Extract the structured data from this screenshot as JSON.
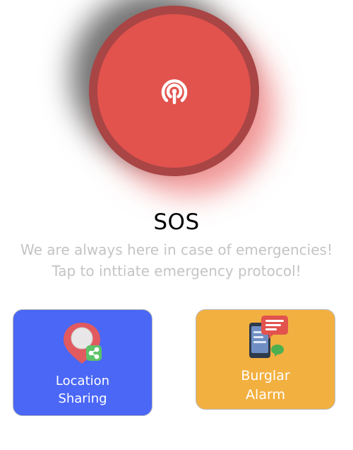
{
  "sos": {
    "title": "SOS",
    "subtitle_line1": "We are always here in case of emergencies!",
    "subtitle_line2": "Tap to inttiate emergency protocol!",
    "icon": "broadcast-signal-icon"
  },
  "cards": {
    "location": {
      "label_line1": "Location",
      "label_line2": "Sharing",
      "icon": "location-share-icon",
      "color": "#4a67f6"
    },
    "burglar": {
      "label_line1": "Burglar",
      "label_line2": "Alarm",
      "icon": "phone-message-icon",
      "color": "#f2b040"
    }
  },
  "colors": {
    "sos_red": "#e2534e",
    "sos_ring": "#a94545",
    "subtitle_gray": "#c4c4c4"
  }
}
